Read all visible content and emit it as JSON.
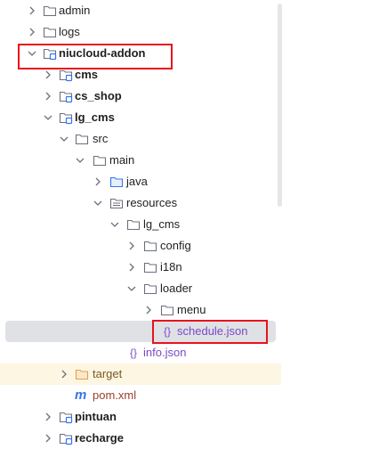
{
  "tree": {
    "items": [
      {
        "label": "admin",
        "icon": "folder-icon",
        "expanded": false
      },
      {
        "label": "logs",
        "icon": "folder-icon",
        "expanded": false
      },
      {
        "label": "niucloud-addon",
        "icon": "module-folder-icon",
        "expanded": true
      },
      {
        "label": "cms",
        "icon": "module-folder-icon",
        "expanded": false
      },
      {
        "label": "cs_shop",
        "icon": "module-folder-icon",
        "expanded": false
      },
      {
        "label": "lg_cms",
        "icon": "module-folder-icon",
        "expanded": true
      },
      {
        "label": "src",
        "icon": "folder-icon",
        "expanded": true
      },
      {
        "label": "main",
        "icon": "folder-icon",
        "expanded": true
      },
      {
        "label": "java",
        "icon": "source-folder-icon",
        "expanded": false
      },
      {
        "label": "resources",
        "icon": "resources-folder-icon",
        "expanded": true
      },
      {
        "label": "lg_cms",
        "icon": "folder-icon",
        "expanded": true
      },
      {
        "label": "config",
        "icon": "folder-icon",
        "expanded": false
      },
      {
        "label": "i18n",
        "icon": "folder-icon",
        "expanded": false
      },
      {
        "label": "loader",
        "icon": "folder-icon",
        "expanded": true
      },
      {
        "label": "menu",
        "icon": "folder-icon",
        "expanded": false
      },
      {
        "label": "schedule.json",
        "icon": "json-file-icon"
      },
      {
        "label": "info.json",
        "icon": "json-file-icon"
      },
      {
        "label": "target",
        "icon": "excluded-folder-icon",
        "expanded": false
      },
      {
        "label": "pom.xml",
        "icon": "maven-file-icon"
      },
      {
        "label": "pintuan",
        "icon": "module-folder-icon",
        "expanded": false
      },
      {
        "label": "recharge",
        "icon": "module-folder-icon",
        "expanded": false
      }
    ]
  },
  "colors": {
    "selection": "#dfe1e5",
    "excluded_row": "#fdf6e3",
    "highlight_box": "#e8131b",
    "folder_stroke": "#6c707e",
    "module_blue": "#3574f0",
    "target_orange": "#e3a044",
    "json_purple": "#7b49c6",
    "xml_red": "#9b3f2a"
  }
}
